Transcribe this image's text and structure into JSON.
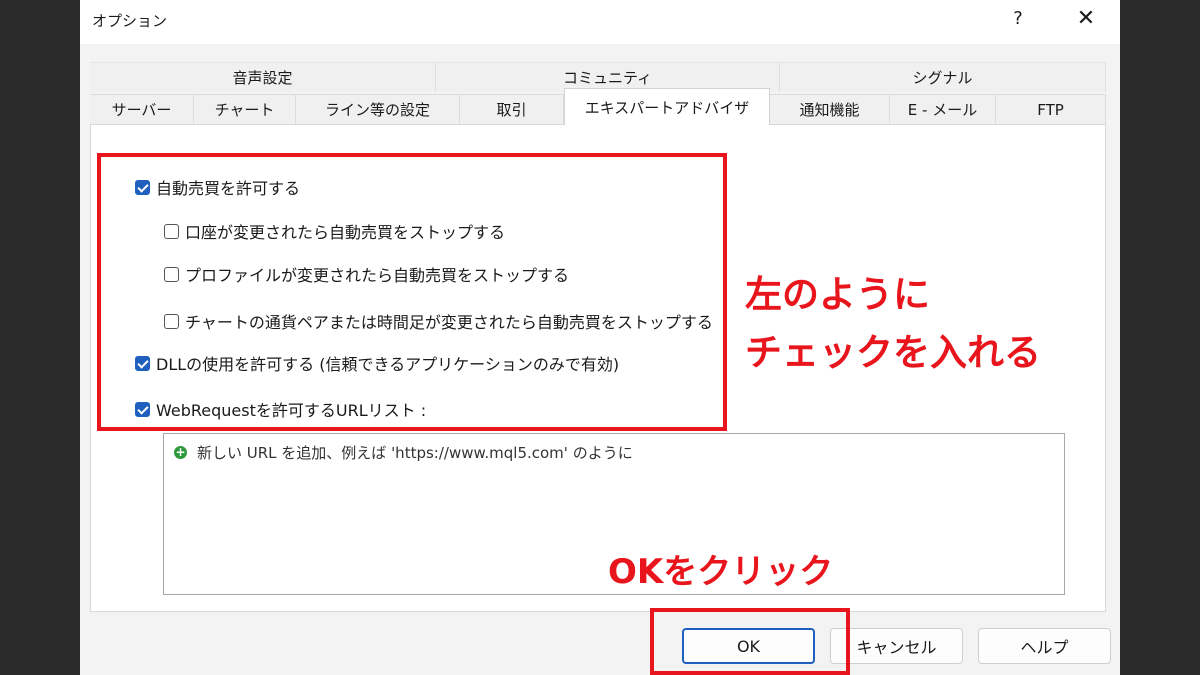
{
  "window": {
    "title": "オプション",
    "help": "?",
    "close": "✕"
  },
  "tabs_back": [
    "音声設定",
    "コミュニティ",
    "シグナル"
  ],
  "tabs_front": [
    "サーバー",
    "チャート",
    "ライン等の設定",
    "取引",
    "エキスパートアドバイザ",
    "通知機能",
    "E - メール",
    "FTP"
  ],
  "active_tab": "エキスパートアドバイザ",
  "options": {
    "auto_trade": {
      "label": "自動売買を許可する",
      "checked": true
    },
    "stop_account": {
      "label": "口座が変更されたら自動売買をストップする",
      "checked": false
    },
    "stop_profile": {
      "label": "プロファイルが変更されたら自動売買をストップする",
      "checked": false
    },
    "stop_chart": {
      "label": "チャートの通貨ペアまたは時間足が変更されたら自動売買をストップする",
      "checked": false
    },
    "dll": {
      "label": "DLLの使用を許可する (信頼できるアプリケーションのみで有効)",
      "checked": true
    },
    "webrequest": {
      "label": "WebRequestを許可するURLリスト :",
      "checked": true
    }
  },
  "url_list": {
    "add_hint": "新しい URL を追加、例えば 'https://www.mql5.com' のように"
  },
  "buttons": {
    "ok": "OK",
    "cancel": "キャンセル",
    "help": "ヘルプ"
  },
  "annotations": {
    "check_line1": "左のように",
    "check_line2": "チェックを入れる",
    "ok_note": "OKをクリック",
    "color": "#e8151c"
  }
}
